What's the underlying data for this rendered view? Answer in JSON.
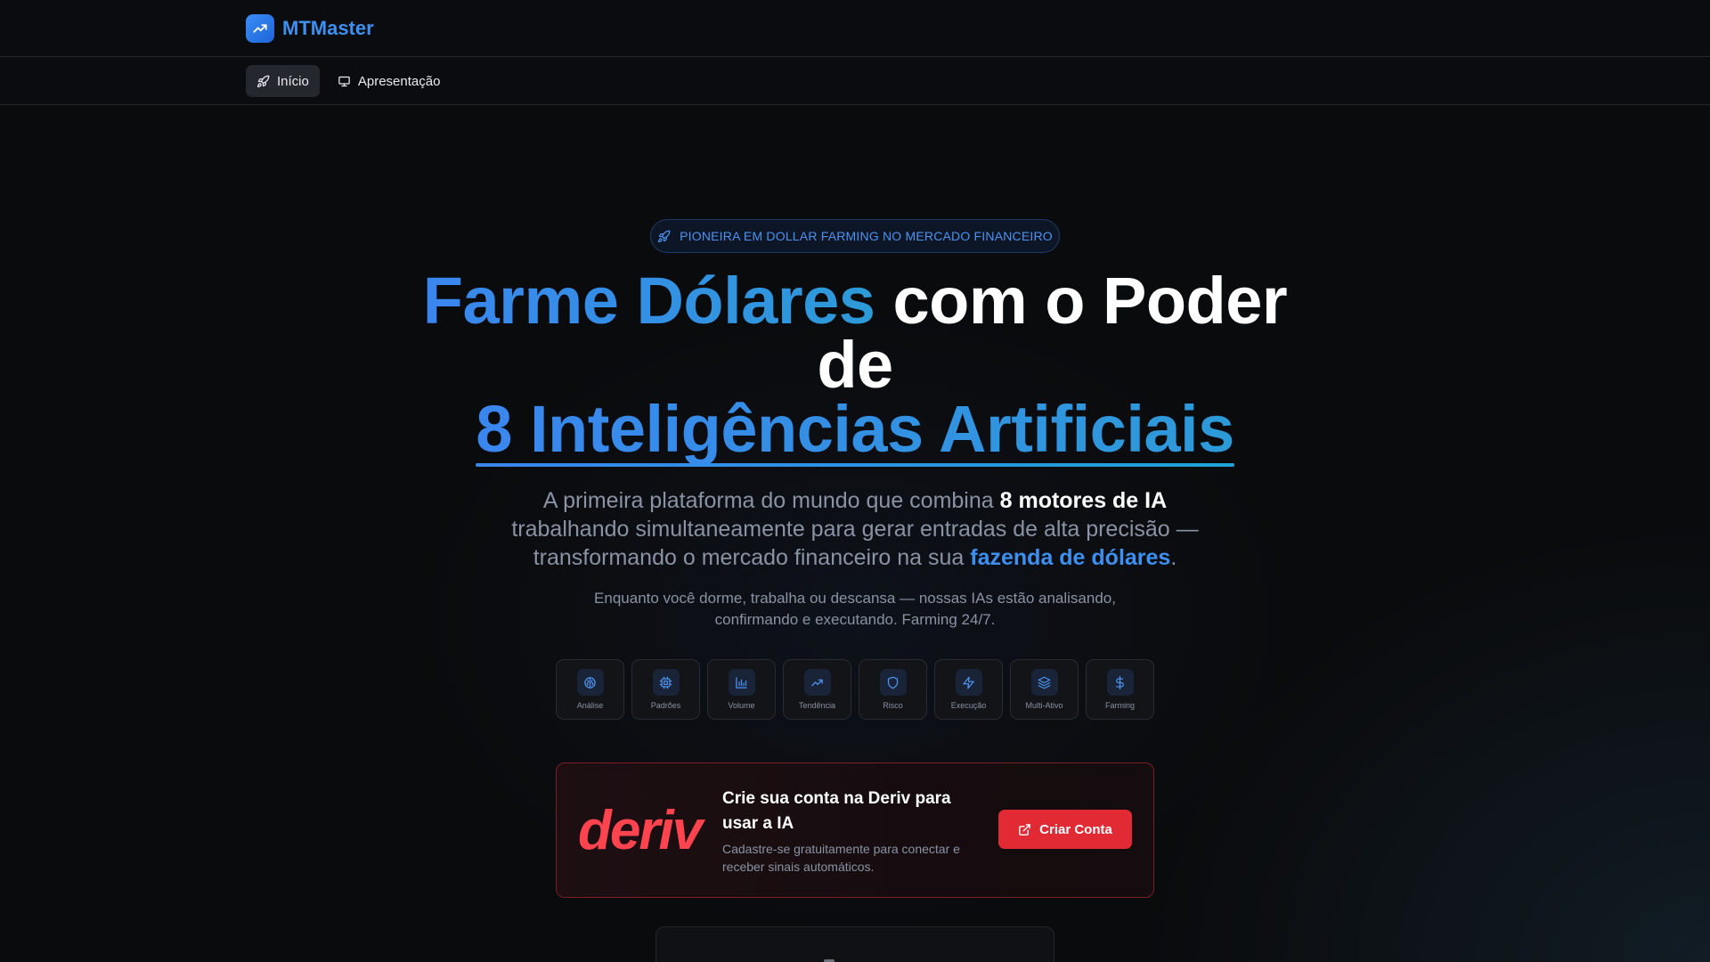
{
  "brand": {
    "name": "MTMaster",
    "logo_icon": "trending-up-icon",
    "accent": "#3d8ff0"
  },
  "nav": {
    "items": [
      {
        "label": "Início",
        "icon": "rocket-icon",
        "active": true
      },
      {
        "label": "Apresentação",
        "icon": "presentation-icon",
        "active": false
      }
    ]
  },
  "hero": {
    "badge": "PIONEIRA EM DOLLAR FARMING NO MERCADO FINANCEIRO",
    "title_part1": "Farme Dólares",
    "title_part2": " com o Poder de",
    "title_part3": "8 Inteligências Artificiais",
    "subtitle_pre": "A primeira plataforma do mundo que combina ",
    "subtitle_bold": "8 motores de IA",
    "subtitle_mid": " trabalhando simultaneamente para gerar entradas de alta precisão — transformando o mercado financeiro na sua ",
    "subtitle_highlight": "fazenda de dólares",
    "subtitle_end": ".",
    "tagline": "Enquanto você dorme, trabalha ou descansa — nossas IAs estão analisando, confirmando e executando. Farming 24/7."
  },
  "ai_engines": [
    {
      "label": "Análise",
      "icon": "brain-icon"
    },
    {
      "label": "Padrões",
      "icon": "cpu-icon"
    },
    {
      "label": "Volume",
      "icon": "bar-chart-icon"
    },
    {
      "label": "Tendência",
      "icon": "trending-up-icon"
    },
    {
      "label": "Risco",
      "icon": "shield-icon"
    },
    {
      "label": "Execução",
      "icon": "zap-icon"
    },
    {
      "label": "Multi-Ativo",
      "icon": "layers-icon"
    },
    {
      "label": "Farming",
      "icon": "dollar-icon"
    }
  ],
  "promo": {
    "logo_text": "deriv",
    "title": "Crie sua conta na Deriv para usar a IA",
    "description": "Cadastre-se gratuitamente para conectar e receber sinais automáticos.",
    "button_label": "Criar Conta",
    "button_icon": "external-link-icon",
    "brand_color": "#ff444f"
  }
}
